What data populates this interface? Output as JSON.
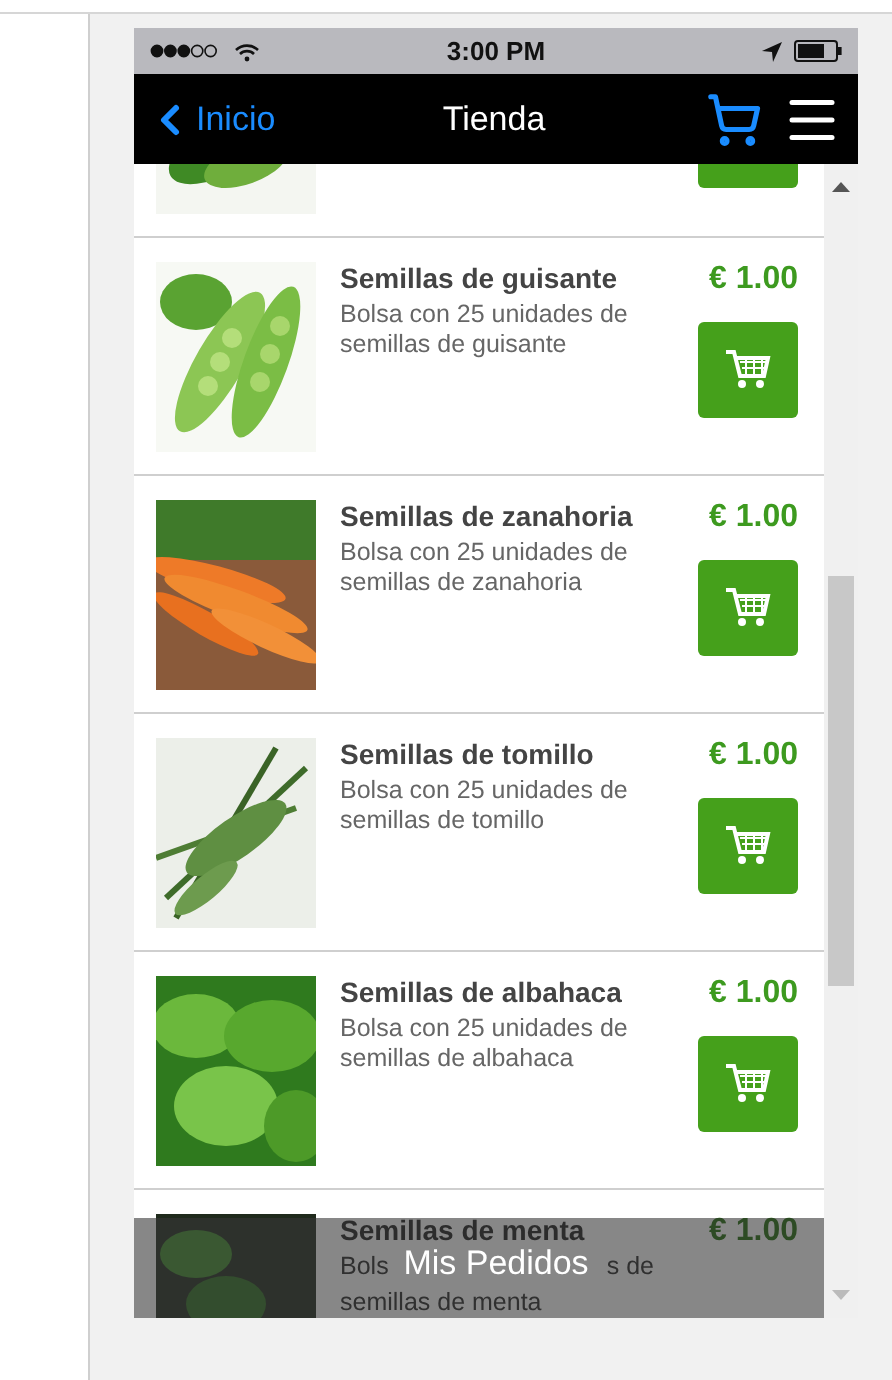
{
  "status_bar": {
    "time": "3:00 PM"
  },
  "nav": {
    "back": "Inicio",
    "title": "Tienda"
  },
  "products": [
    {
      "kind": "partial"
    },
    {
      "kind": "full",
      "name": "Semillas de guisante",
      "description": "Bolsa con 25 unidades de semillas de guisante",
      "price": "€ 1.00"
    },
    {
      "kind": "full",
      "name": "Semillas de zanahoria",
      "description": "Bolsa con 25 unidades de semillas de zanahoria",
      "price": "€ 1.00"
    },
    {
      "kind": "full",
      "name": "Semillas de tomillo",
      "description": "Bolsa con 25 unidades de semillas de tomillo",
      "price": "€ 1.00"
    },
    {
      "kind": "full",
      "name": "Semillas de albahaca",
      "description": "Bolsa con 25 unidades de semillas de albahaca",
      "price": "€ 1.00"
    },
    {
      "kind": "covered",
      "name": "Semillas de menta",
      "description_start": "Bols",
      "description_end": "s de",
      "description_line2": "semillas de menta",
      "price": "€ 1.00"
    }
  ],
  "footer": {
    "label": "Mis Pedidos"
  }
}
